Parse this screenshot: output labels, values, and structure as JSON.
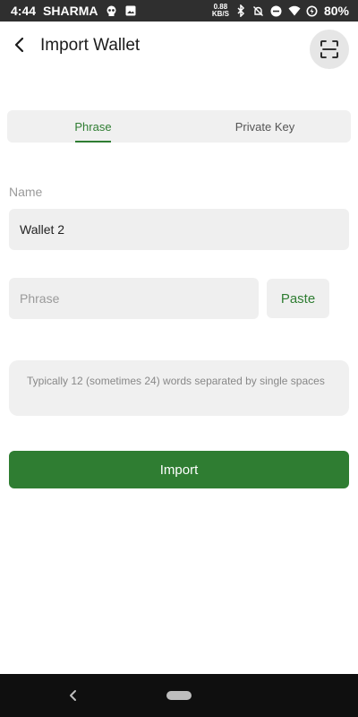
{
  "status_bar": {
    "time": "4:44",
    "carrier": "SHARMA",
    "net_speed_value": "0.88",
    "net_speed_unit": "KB/S",
    "battery": "80%"
  },
  "header": {
    "title": "Import Wallet"
  },
  "tabs": [
    {
      "label": "Phrase",
      "active": true
    },
    {
      "label": "Private Key",
      "active": false
    }
  ],
  "form": {
    "name_label": "Name",
    "name_value": "Wallet 2",
    "phrase_placeholder": "Phrase",
    "paste_label": "Paste",
    "hint": "Typically 12 (sometimes 24) words separated by single spaces",
    "import_label": "Import"
  },
  "colors": {
    "accent": "#2f7d32",
    "field_bg": "#efefef"
  },
  "icons": {
    "back": "arrow-left-icon",
    "scan": "scan-frame-icon"
  }
}
